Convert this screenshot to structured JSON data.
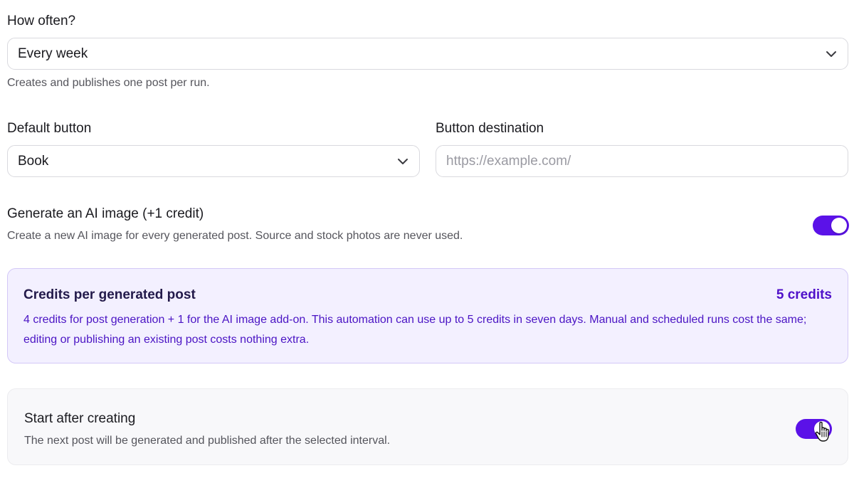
{
  "frequency": {
    "label": "How often?",
    "selected": "Every week",
    "helper": "Creates and publishes one post per run."
  },
  "default_button": {
    "label": "Default button",
    "selected": "Book"
  },
  "button_destination": {
    "label": "Button destination",
    "value": "",
    "placeholder": "https://example.com/"
  },
  "ai_image": {
    "label": "Generate an AI image (+1 credit)",
    "helper": "Create a new AI image for every generated post. Source and stock photos are never used.",
    "enabled": true
  },
  "credits": {
    "title": "Credits per generated post",
    "value": "5 credits",
    "description": "4 credits for post generation + 1 for the AI image add-on. This automation can use up to 5 credits in seven days. Manual and scheduled runs cost the same; editing or publishing an existing post costs nothing extra."
  },
  "start_after_creating": {
    "title": "Start after creating",
    "helper": "The next post will be generated and published after the selected interval.",
    "enabled": true
  },
  "icons": {
    "select_chevron": "chevron-down-icon",
    "pointer": "hand-pointer-icon"
  },
  "colors": {
    "accent": "#5b12e8",
    "credits_text": "#4a14c4",
    "credits_bg": "#f3f0ff"
  }
}
